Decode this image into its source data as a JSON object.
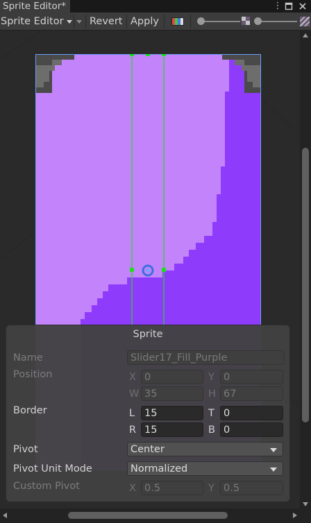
{
  "window": {
    "tab_title": "Sprite Editor*",
    "menu_icon": "kebab-menu-icon",
    "maximize_icon": "maximize-icon",
    "close_icon": "close-icon"
  },
  "toolbar": {
    "mode_label": "Sprite Editor",
    "revert_label": "Revert",
    "apply_label": "Apply",
    "color_channel_icon": "rgb-channel-icon",
    "alpha_icon": "checker-alpha-icon",
    "mip_icon": "mip-level-icon"
  },
  "colors": {
    "sprite_light": "#c384fb",
    "sprite_dark": "#8e3bfc",
    "sprite_border": "#6c9cff",
    "nine_slice_lines": "#20dd20",
    "corner_grey_dark": "#4a4a4a",
    "corner_grey_mid": "#6d6d6d",
    "pivot": "#3c6fe0"
  },
  "sprite_panel": {
    "title": "Sprite",
    "name": {
      "label": "Name",
      "value": "Slider17_Fill_Purple"
    },
    "position": {
      "label": "Position",
      "x_label": "X",
      "x": "0",
      "y_label": "Y",
      "y": "0",
      "w_label": "W",
      "w": "35",
      "h_label": "H",
      "h": "67"
    },
    "border": {
      "label": "Border",
      "l_label": "L",
      "l": "15",
      "t_label": "T",
      "t": "0",
      "r_label": "R",
      "r": "15",
      "b_label": "B",
      "b": "0"
    },
    "pivot": {
      "label": "Pivot",
      "value": "Center"
    },
    "pivot_unit_mode": {
      "label": "Pivot Unit Mode",
      "value": "Normalized"
    },
    "custom_pivot": {
      "label": "Custom Pivot",
      "x_label": "X",
      "x": "0.5",
      "y_label": "Y",
      "y": "0.5"
    }
  }
}
